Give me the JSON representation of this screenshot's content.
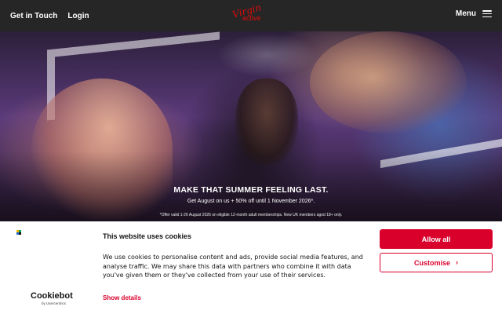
{
  "header": {
    "nav": [
      "Get in Touch",
      "Login"
    ],
    "logo_script": "Virgin",
    "logo_word": "active",
    "menu_label": "Menu",
    "menu_icon": "hamburger-icon"
  },
  "hero": {
    "title": "MAKE THAT SUMMER FEELING LAST.",
    "subtitle": "Get August on us + 50% off until 1 November 2026*.",
    "fine_print": "*Offer valid 1-26 August 2026 on eligible 12-month adult memberships. New UK members aged 18+ only."
  },
  "cookie_banner": {
    "title": "This website uses cookies",
    "body": "We use cookies to personalise content and ads, provide social media features, and analyse traffic. We may share this data with partners who combine it with data you've given them or they've collected from your use of their services.",
    "show_details": "Show details",
    "allow_all": "Allow all",
    "customise": "Customise",
    "customise_icon": "chevron-right-icon",
    "provider_logo": "Cookiebot",
    "provider_by": "by Usercentrics",
    "accent_color": "#d9002b"
  }
}
